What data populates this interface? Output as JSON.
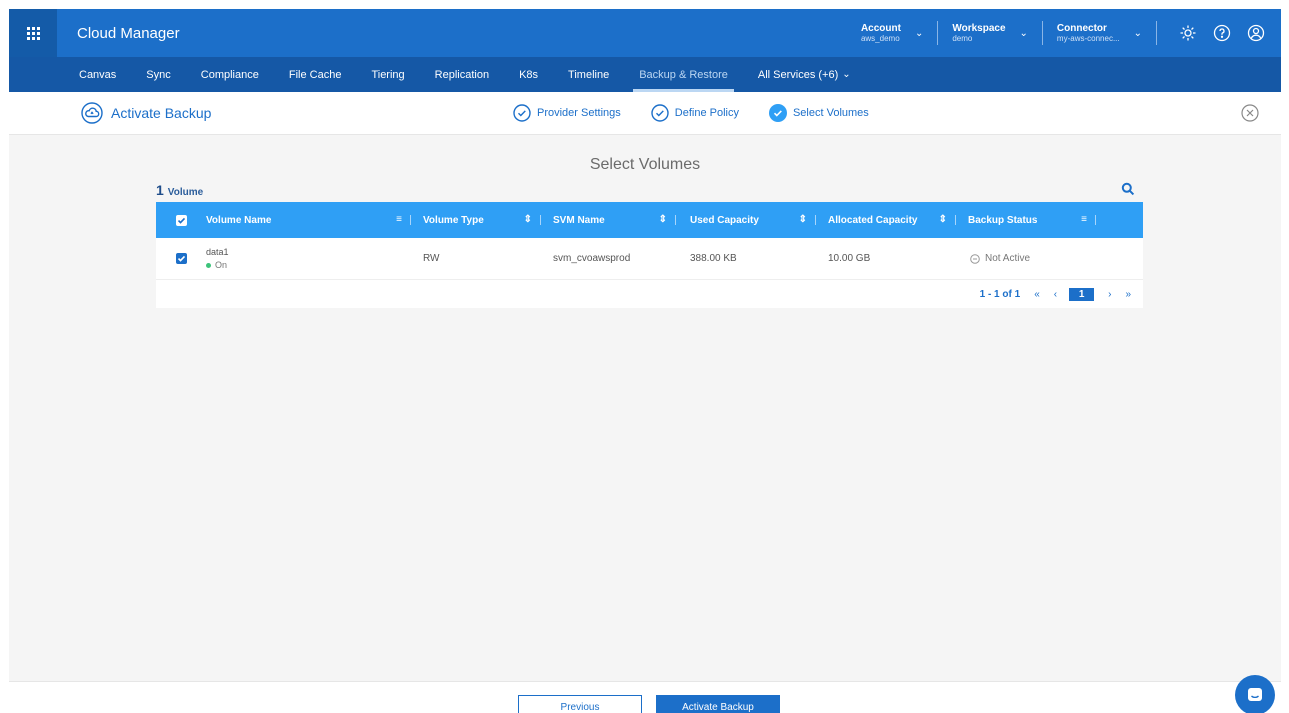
{
  "topbar": {
    "app_title": "Cloud Manager",
    "account": {
      "label": "Account",
      "value": "aws_demo"
    },
    "workspace": {
      "label": "Workspace",
      "value": "demo"
    },
    "connector": {
      "label": "Connector",
      "value": "my-aws-connec..."
    }
  },
  "nav": {
    "items": [
      "Canvas",
      "Sync",
      "Compliance",
      "File Cache",
      "Tiering",
      "Replication",
      "K8s",
      "Timeline",
      "Backup & Restore",
      "All Services (+6)"
    ],
    "active": "Backup & Restore"
  },
  "wizard": {
    "title": "Activate Backup",
    "steps": [
      "Provider Settings",
      "Define Policy",
      "Select Volumes"
    ]
  },
  "content": {
    "title": "Select Volumes",
    "count": "1",
    "count_unit": "Volume"
  },
  "table": {
    "columns": [
      "Volume Name",
      "Volume Type",
      "SVM Name",
      "Used Capacity",
      "Allocated Capacity",
      "Backup Status"
    ],
    "rows": [
      {
        "name": "data1",
        "state": "On",
        "type": "RW",
        "svm": "svm_cvoawsprod",
        "used": "388.00 KB",
        "allocated": "10.00 GB",
        "backup_status": "Not Active"
      }
    ],
    "pagination": {
      "range": "1 - 1 of 1",
      "current_page": "1"
    }
  },
  "footer": {
    "previous": "Previous",
    "activate": "Activate Backup"
  },
  "colors": {
    "primary": "#1c6fc9",
    "nav": "#1558a6",
    "table_header": "#2f9ff5",
    "status_on": "#3cc37a"
  }
}
